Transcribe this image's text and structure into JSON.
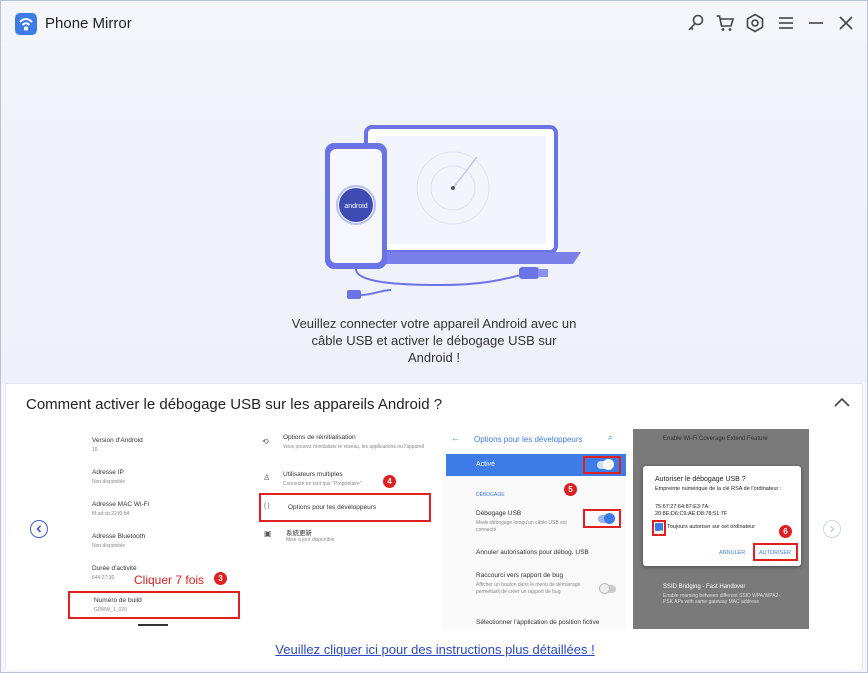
{
  "app": {
    "title": "Phone Mirror"
  },
  "titlebar": {
    "icons": [
      "search-key-icon",
      "cart-icon",
      "gear-icon",
      "menu-icon",
      "minimize-icon",
      "close-icon"
    ]
  },
  "hero": {
    "line1": "Veuillez connecter votre appareil Android avec un",
    "line2": "câble USB et activer le débogage USB sur",
    "line3": "Android !",
    "phone_label": "android"
  },
  "guide": {
    "title": "Comment activer le débogage USB sur les appareils Android ?",
    "link": "Veuillez cliquer ici pour des instructions plus détaillées !"
  },
  "step1": {
    "items": [
      {
        "label": "Version d'Android",
        "sub": "10"
      },
      {
        "label": "Adresse IP",
        "sub": "Non disponible"
      },
      {
        "label": "Adresse MAC Wi-Fi",
        "sub": "f8:ad:cb:22:f0:b4"
      },
      {
        "label": "Adresse Bluetooth",
        "sub": "Non disponible"
      },
      {
        "label": "Durée d'activité",
        "sub": "644:27:30"
      }
    ],
    "hint": "Cliquer 7 fois",
    "badge": "3",
    "build": {
      "label": "Numéro de build",
      "sub": "G0WW_1_020"
    }
  },
  "step2": {
    "items": [
      {
        "label": "Options de réinitialisation",
        "sub": "Vous pouvez réinitialiser le réseau, les applications ou l'appareil"
      },
      {
        "label": "Utilisateurs multiples",
        "sub": "Connecté en tant que \"Propriétaire\""
      },
      {
        "label": "Options pour les développeurs",
        "sub": ""
      },
      {
        "label": "系統更新",
        "sub": "Mise à jour disponible"
      }
    ],
    "badge": "4"
  },
  "step3": {
    "header": "Options pour les développeurs",
    "active": "Activé",
    "section": "DÉBOGAGE",
    "usb": {
      "label": "Débogage USB",
      "sub": "Mode débogage lorsqu'un câble USB est connecté"
    },
    "revoke": "Annuler autorisations pour débog. USB",
    "bug": {
      "label": "Raccourci vers rapport de bug",
      "sub": "Afficher un bouton dans le menu de démarrage permettant de créer un rapport de bug"
    },
    "mock": "Sélectionner l'application de position fictive",
    "badge": "5"
  },
  "step4": {
    "bg1": "Enable Wi-Fi Coverage Extend Feature",
    "dialog_title": "Autoriser le débogage USB ?",
    "fingerprint_label": "Empreinte numérique de la clé RSA de l'ordinateur :",
    "fingerprint_1": "75:67:27:64:87:E3:7A:",
    "fingerprint_2": "20:8E:D6:C9:AE:D8:78:51:7F",
    "always": "Toujours autoriser sur cet ordinateur",
    "cancel": "ANNULER",
    "allow": "AUTORISER",
    "bg2": "SSID Bridging - Fast Handover",
    "bg2_sub": "Enable roaming between different SSID WPA/WPA2-PSK APs with same gateway MAC address",
    "badge": "6"
  }
}
